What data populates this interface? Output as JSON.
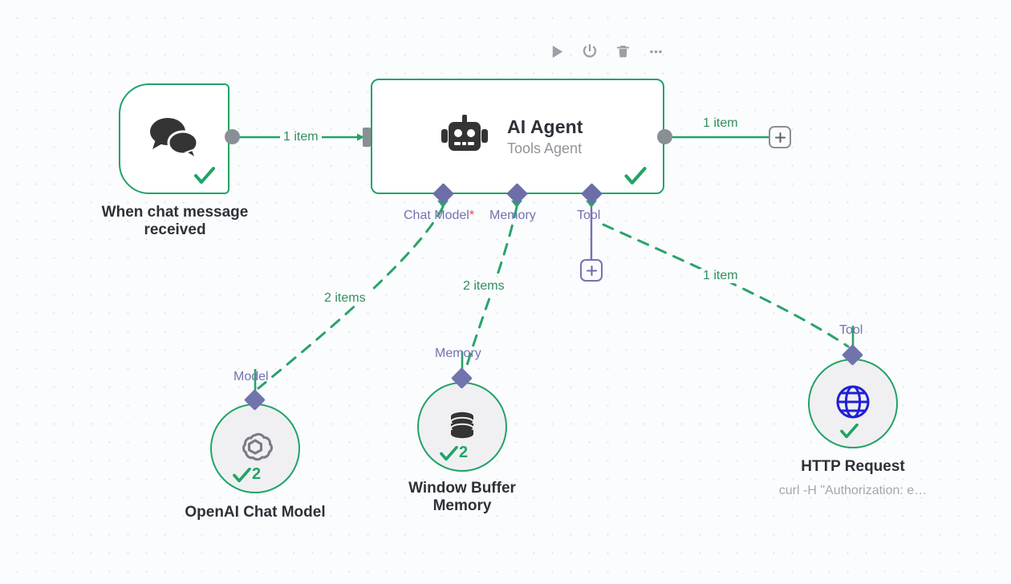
{
  "canvas": {
    "background_color": "#fbfcfe",
    "grid_dot_color": "#e3e5ea",
    "accent_green": "#21a366",
    "accent_purple": "#6d6ea8",
    "accent_red": "#ff6d5a",
    "port_gray": "#8a8f96"
  },
  "toolbar": {
    "items": [
      {
        "icon": "play-icon",
        "label": "Execute workflow"
      },
      {
        "icon": "power-icon",
        "label": "Deactivate"
      },
      {
        "icon": "trash-icon",
        "label": "Delete"
      },
      {
        "icon": "ellipsis-icon",
        "label": "More options"
      }
    ]
  },
  "nodes": {
    "trigger": {
      "title": "When chat message\nreceived",
      "icon": "chat-bubbles-icon",
      "trigger_icon": "lightning-bolt-icon",
      "status": "success",
      "status_icon": "check-icon"
    },
    "agent": {
      "title": "AI Agent",
      "subtitle": "Tools Agent",
      "icon": "robot-icon",
      "status": "success",
      "status_icon": "check-icon"
    },
    "chat_model": {
      "title": "OpenAI Chat Model",
      "icon": "openai-logo-icon",
      "status_icon": "check-icon",
      "run_count": "2",
      "port_label": "Model"
    },
    "memory": {
      "title": "Window Buffer\nMemory",
      "icon": "database-icon",
      "status_icon": "check-icon",
      "run_count": "2",
      "port_label": "Memory"
    },
    "http": {
      "title": "HTTP Request",
      "subtitle": "curl -H \"Authorization: e…",
      "icon": "globe-icon",
      "status_icon": "check-icon",
      "port_label": "Tool"
    }
  },
  "agent_ports": {
    "chat_model": {
      "label": "Chat Model",
      "required_marker": "*"
    },
    "memory": {
      "label": "Memory"
    },
    "tool": {
      "label": "Tool"
    }
  },
  "edges": {
    "trigger_to_agent": "1 item",
    "agent_to_next": "1 item",
    "agent_to_chat_model": "2 items",
    "agent_to_memory": "2 items",
    "agent_to_http": "1 item"
  },
  "buttons": {
    "add_main_node": "+",
    "add_tool_node": "+"
  }
}
